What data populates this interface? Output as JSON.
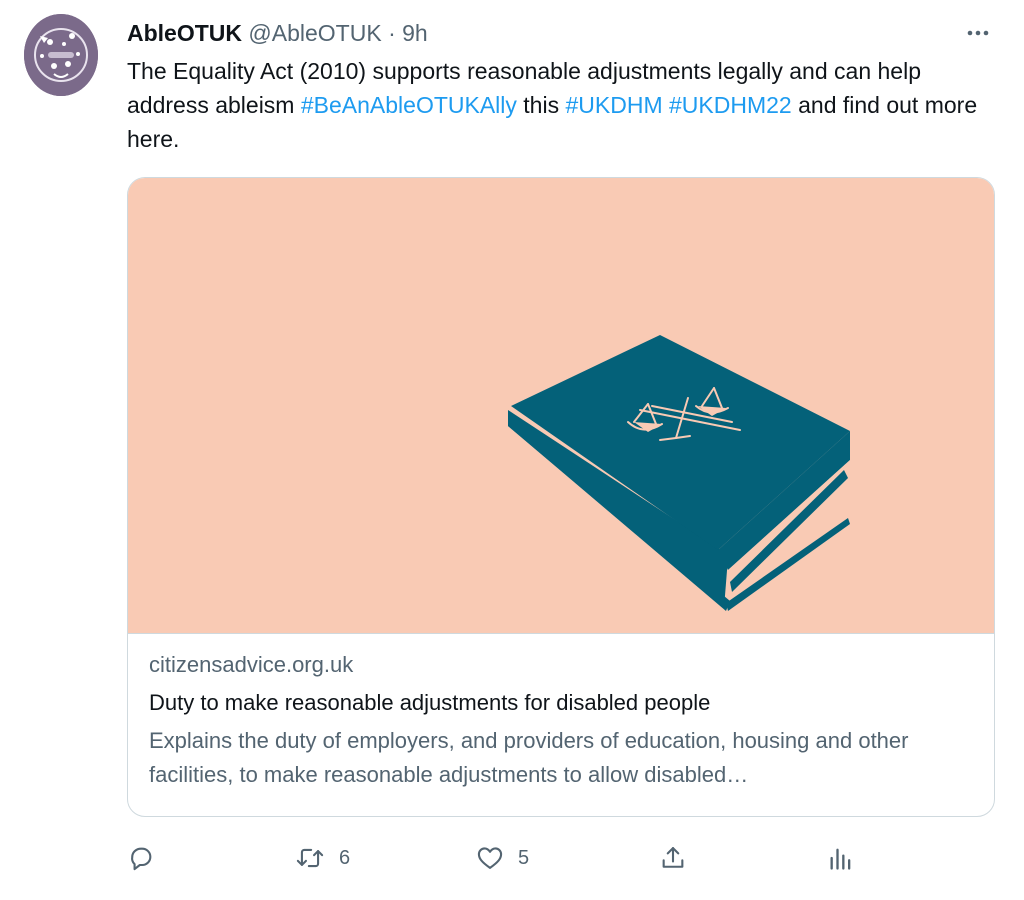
{
  "author": {
    "display_name": "AbleOTUK",
    "handle": "@AbleOTUK",
    "separator": "·",
    "time": "9h"
  },
  "tweet": {
    "text_1": "The Equality Act (2010) supports reasonable adjustments legally and can help address ableism ",
    "hashtag_1": "#BeAnAbleOTUKAlly",
    "text_2": " this ",
    "hashtag_2": "#UKDHM",
    "text_3": " ",
    "hashtag_3": "#UKDHM22",
    "text_4": " and find out more here."
  },
  "card": {
    "domain": "citizensadvice.org.uk",
    "title": "Duty to make reasonable adjustments for disabled people",
    "description": "Explains the duty of employers, and providers of education, housing and other facilities, to make reasonable adjustments to allow disabled…",
    "image_icon": "law-book-scales-icon"
  },
  "actions": {
    "reply_count": "",
    "retweet_count": "6",
    "like_count": "5",
    "share_count": "",
    "analytics_count": ""
  },
  "colors": {
    "link": "#1d9bf0",
    "secondary_text": "#536471",
    "card_background": "#f9cab4",
    "book_color": "#046179",
    "avatar_background": "#7b6a8a"
  }
}
